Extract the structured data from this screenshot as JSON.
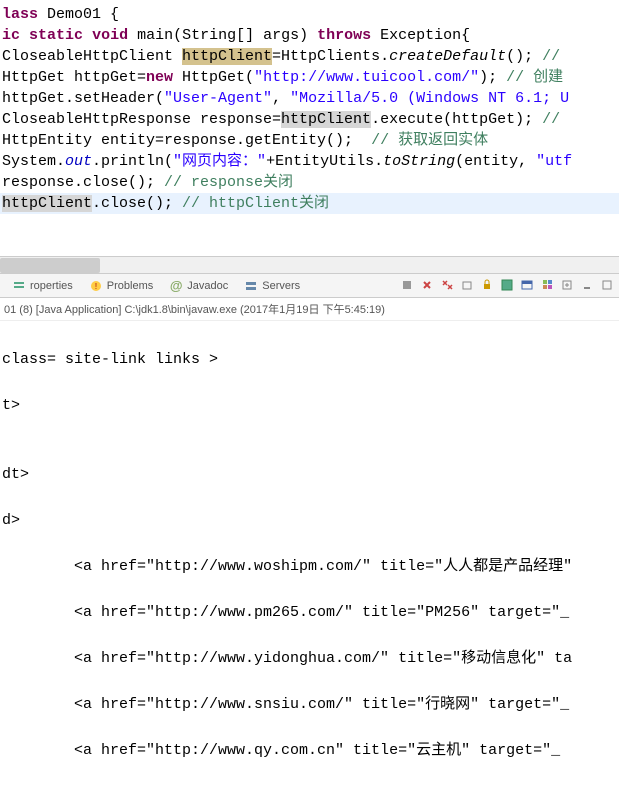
{
  "code": {
    "l1": {
      "a": "lass",
      "b": " Demo01 {"
    },
    "l2": "",
    "l3": {
      "a": "ic",
      "b": "static",
      "c": "void",
      "d": " main(String[] args) ",
      "e": "throws",
      "f": " Exception{"
    },
    "l4": {
      "a": "CloseableHttpClient ",
      "b": "httpClient",
      "c": "=HttpClients.",
      "d": "createDefault",
      "e": "(); ",
      "f": "//"
    },
    "l5": {
      "a": "HttpGet httpGet=",
      "b": "new",
      "c": " HttpGet(",
      "d": "\"http://www.tuicool.com/\"",
      "e": "); ",
      "f": "// 创建"
    },
    "l6": {
      "a": "httpGet.setHeader(",
      "b": "\"User-Agent\"",
      "c": ", ",
      "d": "\"Mozilla/5.0 (Windows NT 6.1; U",
      "e": ""
    },
    "l7": {
      "a": "CloseableHttpResponse response=",
      "b": "httpClient",
      "c": ".execute(httpGet); ",
      "d": "//"
    },
    "l8": {
      "a": "HttpEntity entity=response.getEntity();  ",
      "b": "// 获取返回实体"
    },
    "l9": {
      "a": "System.",
      "b": "out",
      "c": ".println(",
      "d": "\"网页内容：\"",
      "e": "+EntityUtils.",
      "f": "toString",
      "g": "(entity, ",
      "h": "\"utf"
    },
    "l10": {
      "a": "response.close(); ",
      "b": "// response关闭"
    },
    "l11": {
      "a": "httpClient",
      "b": ".close(); ",
      "c": "// httpClient关闭"
    }
  },
  "tabs": {
    "t1": "roperties",
    "t2": "Problems",
    "t3": "Javadoc",
    "t4": "Servers"
  },
  "console_header": "01 (8) [Java Application] C:\\jdk1.8\\bin\\javaw.exe (2017年1月19日 下午5:45:19)",
  "console": {
    "l1": "class= site-link links >",
    "l2": "t>",
    "l3": "",
    "l4": "dt>",
    "l5": "d>",
    "a1": "        <a href=\"http://www.woshipm.com/\" title=\"人人都是产品经理\"",
    "a2": "        <a href=\"http://www.pm265.com/\" title=\"PM256\" target=\"_",
    "a3": "        <a href=\"http://www.yidonghua.com/\" title=\"移动信息化\" ta",
    "a4": "        <a href=\"http://www.snsiu.com/\" title=\"行晓网\" target=\"_",
    "a5": "        <a href=\"http://www.qy.com.cn\" title=\"云主机\" target=\"_"
  }
}
